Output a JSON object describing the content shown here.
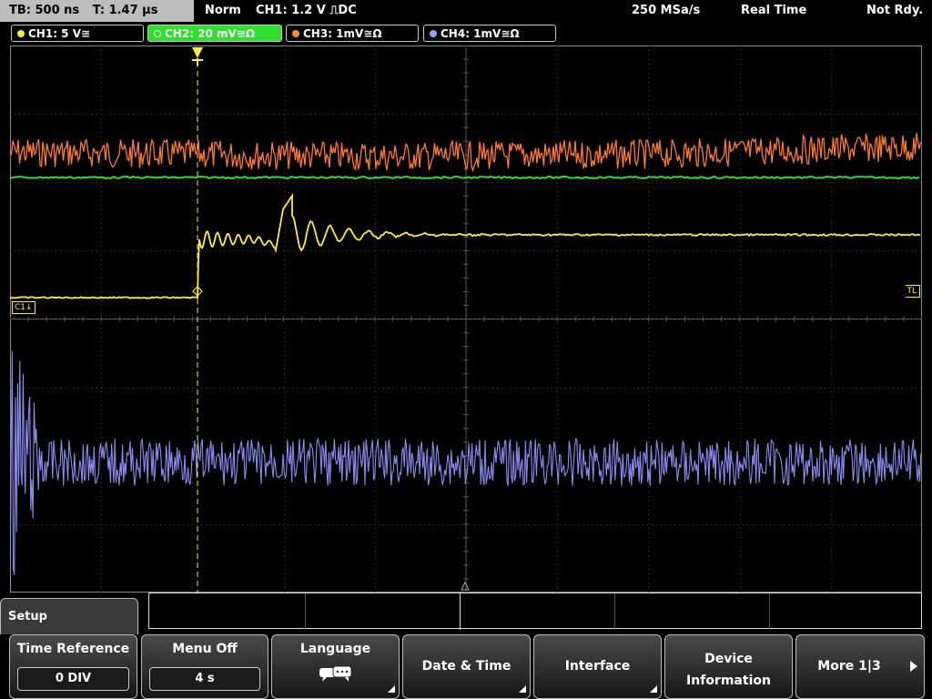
{
  "status": {
    "timebase": "TB: 500 ns",
    "trigger_time": "T: 1.47 µs",
    "trigger_mode": "Norm",
    "trigger_source": "CH1: 1.2 V ⎍DC",
    "sample_rate": "250 MSa/s",
    "acq_mode": "Real Time",
    "state": "Not Rdy."
  },
  "channels": [
    {
      "label": "CH1: 5 V≅",
      "color": "#ffeb3b",
      "active": false
    },
    {
      "label": "CH2: 20 mV≅Ω",
      "color": "#5cc84a",
      "active": true
    },
    {
      "label": "CH3: 1mV≅Ω",
      "color": "#ff8a3d",
      "active": false
    },
    {
      "label": "CH4: 1mV≅Ω",
      "color": "#9a9cff",
      "active": false
    }
  ],
  "markers": {
    "ch1": "C1",
    "trigger_level": "TL"
  },
  "menu": {
    "title": "Setup",
    "softkeys": [
      {
        "label": "Time Reference",
        "value": "0 DIV"
      },
      {
        "label": "Menu Off",
        "value": "4 s"
      },
      {
        "label": "Language",
        "icon": "speech-bubble-icon"
      },
      {
        "label": "Date & Time"
      },
      {
        "label": "Interface"
      },
      {
        "label": "Device Information"
      },
      {
        "label": "More 1|3",
        "icon": "triangle-right-icon"
      }
    ]
  },
  "colors": {
    "ch1": "#ffeb3b",
    "ch2": "#3cd63c",
    "ch3": "#ff7a2e",
    "ch4": "#8c8cf0",
    "grid": "#3a3a3a",
    "active_tab": "#2ee02e"
  }
}
